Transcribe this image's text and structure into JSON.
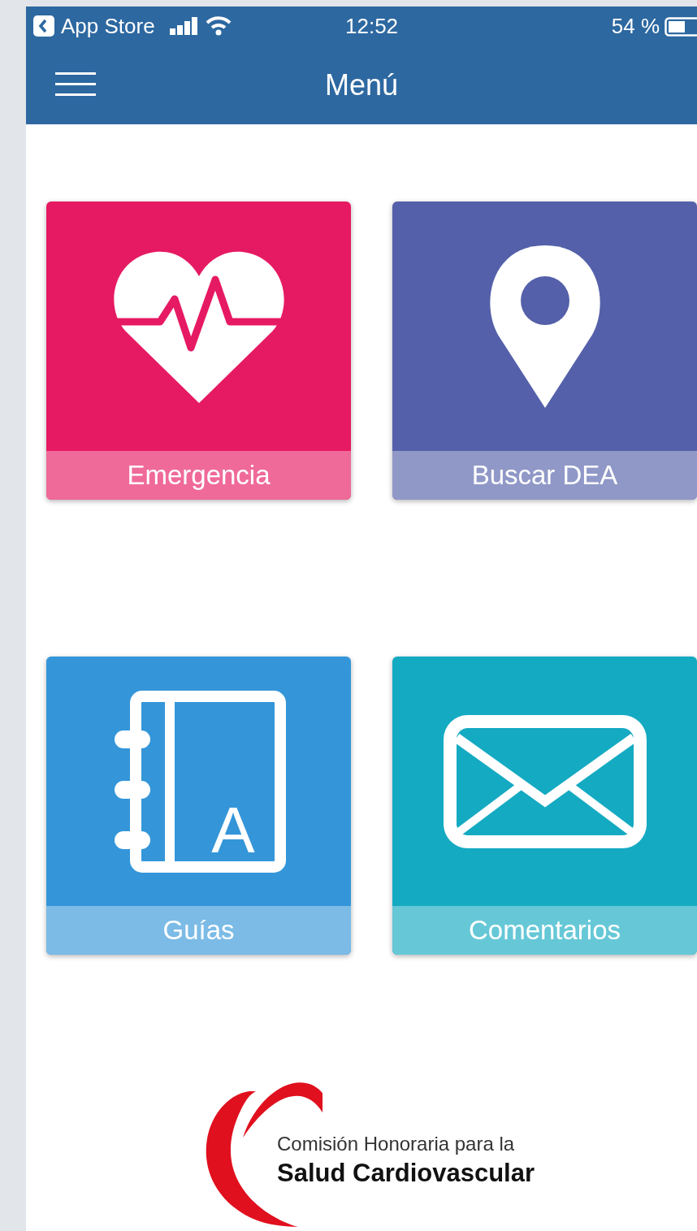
{
  "status_bar": {
    "back_label": "App Store",
    "time": "12:52",
    "battery": "54 %"
  },
  "nav_bar": {
    "title": "Menú"
  },
  "tiles": [
    {
      "kind": "heart",
      "label": "Emergencia",
      "color": "#e61a62"
    },
    {
      "kind": "pin",
      "label": "Buscar DEA",
      "color": "#5460a9"
    },
    {
      "kind": "book",
      "label": "Guías",
      "color": "#3496d9",
      "icon_letter": "A"
    },
    {
      "kind": "mail",
      "label": "Comentarios",
      "color": "#14aac2"
    }
  ],
  "logo": {
    "line1": "Comisión Honoraria para la",
    "line2": "Salud Cardiovascular"
  }
}
